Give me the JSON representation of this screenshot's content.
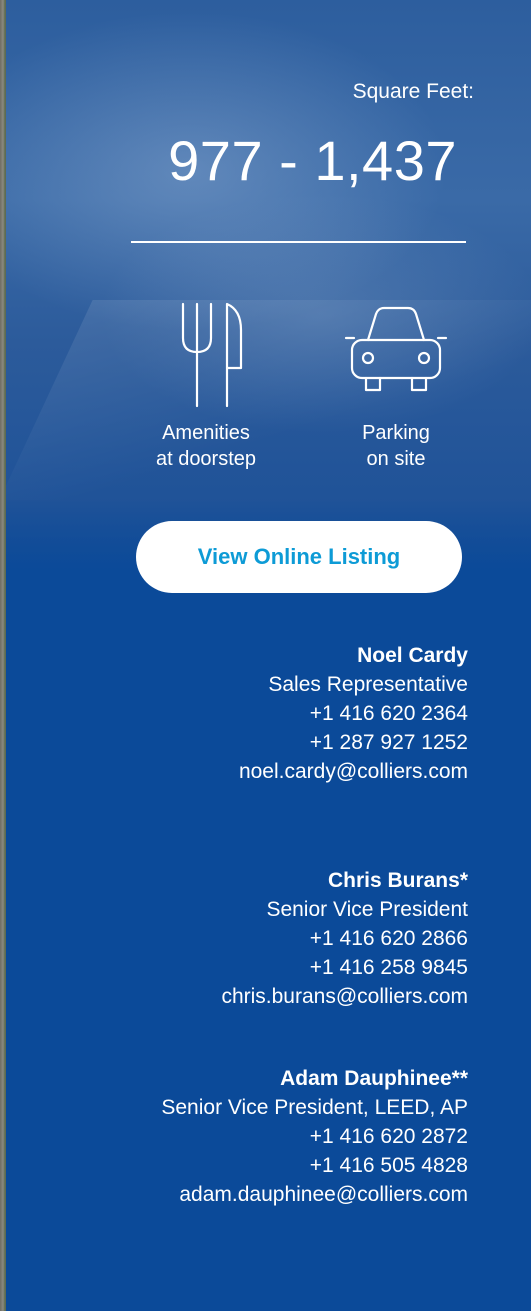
{
  "square_feet": {
    "label": "Square Feet:",
    "value": "977 - 1,437"
  },
  "features": [
    {
      "icon": "fork-knife-icon",
      "line1": "Amenities",
      "line2": "at doorstep"
    },
    {
      "icon": "car-icon",
      "line1": "Parking",
      "line2": "on site"
    }
  ],
  "cta": {
    "label": "View Online Listing"
  },
  "contacts": [
    {
      "name": "Noel Cardy",
      "title": "Sales Representative",
      "phone1": "+1 416 620 2364",
      "phone2": "+1 287 927 1252",
      "email": "noel.cardy@colliers.com"
    },
    {
      "name": "Chris Burans*",
      "title": "Senior Vice President",
      "phone1": "+1 416 620 2866",
      "phone2": "+1 416 258 9845",
      "email": "chris.burans@colliers.com"
    },
    {
      "name": "Adam Dauphinee**",
      "title": "Senior Vice President, LEED, AP",
      "phone1": "+1 416 620 2872",
      "phone2": "+1 416 505 4828",
      "email": "adam.dauphinee@colliers.com"
    }
  ],
  "colors": {
    "panel": "#0b4a99",
    "button_text": "#0d9bd6",
    "text": "#ffffff"
  }
}
